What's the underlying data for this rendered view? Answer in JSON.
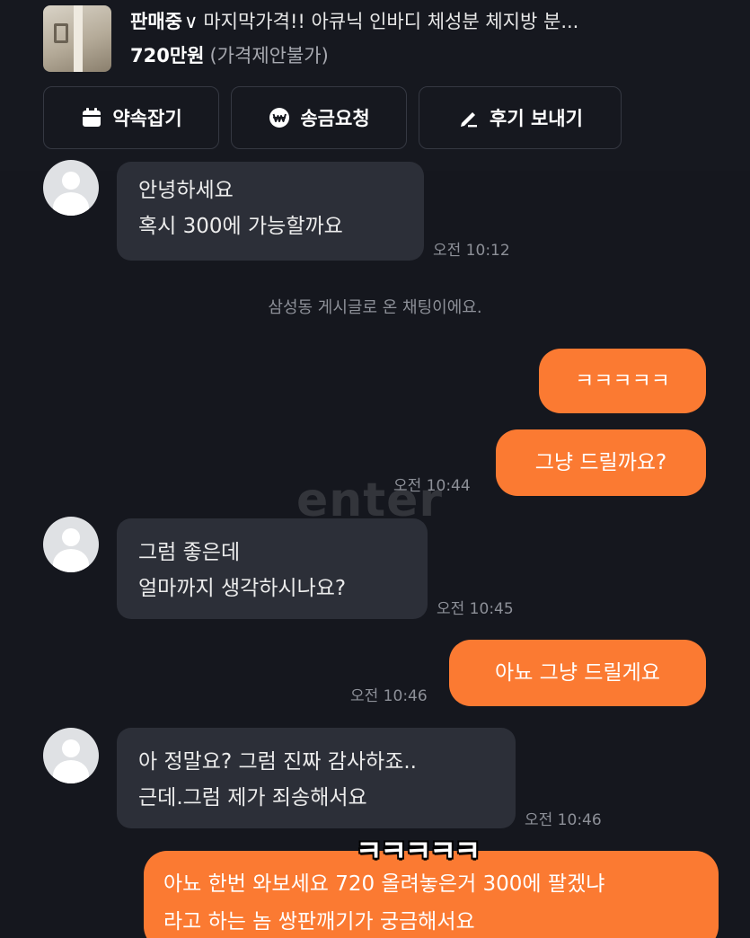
{
  "listing": {
    "status": "판매중",
    "chevron": "∨",
    "title": "마지막가격!! 아큐닉 인바디 체성분 체지방 분...",
    "price": "720만원",
    "price_note": "(가격제안불가)"
  },
  "actions": [
    {
      "label": "약속잡기",
      "icon": "calendar-icon"
    },
    {
      "label": "송금요청",
      "icon": "won-icon"
    },
    {
      "label": "후기 보내기",
      "icon": "pencil-icon"
    }
  ],
  "messages": {
    "m1": {
      "lines": [
        "안녕하세요",
        "혹시 300에 가능할까요"
      ],
      "time": "오전 10:12"
    },
    "system": "삼성동 게시글로 온 채팅이에요.",
    "m2": {
      "text": "ㅋㅋㅋㅋㅋ"
    },
    "m3": {
      "text": "그냥 드릴까요?",
      "time": "오전 10:44"
    },
    "m4": {
      "lines": [
        "그럼 좋은데",
        "얼마까지 생각하시나요?"
      ],
      "time": "오전 10:45"
    },
    "m5": {
      "text": "아뇨 그냥 드릴게요",
      "time": "오전 10:46"
    },
    "m6": {
      "lines": [
        "아 정말요? 그럼 진짜 감사하죠..",
        "근데.그럼 제가 죄송해서요"
      ],
      "time": "오전 10:46"
    },
    "m7": {
      "lines": [
        "아뇨 한번 와보세요 720 올려놓은거 300에 팔겠냐",
        "라고 하는 놈 쌍판깨기가 궁금해서요"
      ]
    }
  },
  "overlay": {
    "watermark": "enter",
    "caption": "ㅋㅋㅋㅋㅋ"
  },
  "colors": {
    "background": "#15171e",
    "incoming_bubble": "#2c2f38",
    "outgoing_bubble": "#fb7a32"
  }
}
